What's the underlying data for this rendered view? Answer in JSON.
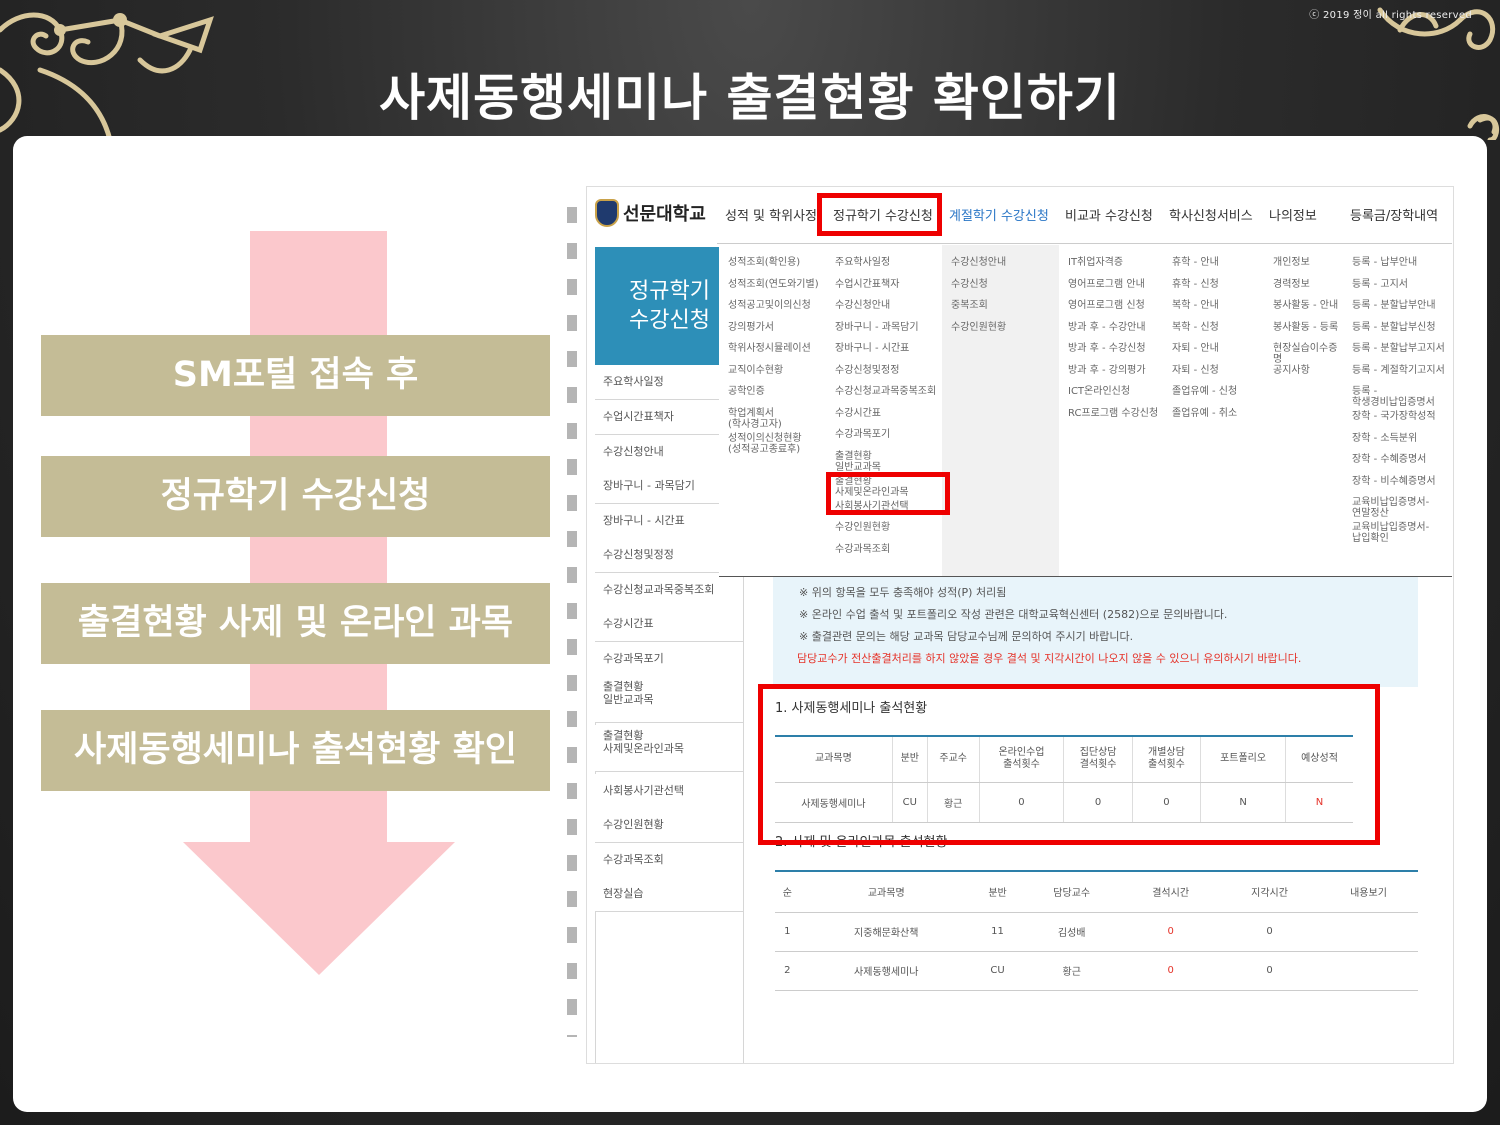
{
  "slide": {
    "title": "사제동행세미나 출결현황 확인하기",
    "copyright": "ⓒ 2019 정이 all rights reserved"
  },
  "steps": [
    "SM포털 접속 후",
    "정규학기 수강신청",
    "출결현황 사제 및 온라인 과목",
    "사제동행세미나 출석현황 확인"
  ],
  "colors": {
    "step_bg": "#c4bc96",
    "arrow": "#fbc8cc",
    "highlight": "#ee0000",
    "accent_blue": "#2d8fb8",
    "warning_red": "#e5332a"
  },
  "portal": {
    "logo": "선문대학교",
    "topnav": [
      "성적 및 학위사정",
      "정규학기 수강신청",
      "계절학기 수강신청",
      "비교과 수강신청",
      "학사신청서비스",
      "나의정보",
      "등록금/장학내역"
    ],
    "side_header": [
      "정규학기",
      "수강신청"
    ],
    "side_items": [
      "주요학사일정",
      "수업시간표책자",
      "수강신청안내",
      "장바구니 - 과목담기",
      "장바구니 - 시간표",
      "수강신청및정정",
      "수강신청교과목중복조회",
      "수강시간표",
      "수강과목포기",
      "출결현황\n일반교과목",
      "출결현황\n사제및온라인과목",
      "사회봉사기관선택",
      "수강인원현황",
      "수강과목조회",
      "현장실습"
    ],
    "mega_cols": [
      [
        "성적조회(확인용)",
        "성적조회(연도와기별)",
        "성적공고및이의신청",
        "강의평가서",
        "학위사정시뮬레이션",
        "교직이수현황",
        "공학인증",
        "학업계획서\n(학사경고자)",
        "성적이의신청현황\n(성적공고종료후)"
      ],
      [
        "주요학사일정",
        "수업시간표책자",
        "수강신청안내",
        "장바구니 - 과목담기",
        "장바구니 - 시간표",
        "수강신청및정정",
        "수강신청교과목중복조회",
        "수강시간표",
        "수강과목포기",
        "출결현황\n일반교과목",
        "출결현황\n사제및온라인과목",
        "사회봉사기관선택",
        "수강인원현황",
        "수강과목조회"
      ],
      [
        "수강신청안내",
        "수강신청",
        "중복조회",
        "수강인원현황"
      ],
      [
        "IT취업자격증",
        "영어프로그램 안내",
        "영어프로그램 신청",
        "방과 후 - 수강안내",
        "방과 후 - 수강신청",
        "방과 후 - 강의평가",
        "ICT온라인신청",
        "RC프로그램 수강신청"
      ],
      [
        "휴학 - 안내",
        "휴학 - 신청",
        "복학 - 안내",
        "복학 - 신청",
        "자퇴 - 안내",
        "자퇴 - 신청",
        "졸업유예 - 신청",
        "졸업유예 - 취소"
      ],
      [
        "개인정보",
        "경력정보",
        "봉사활동 - 안내",
        "봉사활동 - 등록",
        "현장실습이수증명",
        "공지사항"
      ],
      [
        "등록 - 납부안내",
        "등록 - 고지서",
        "등록 - 분할납부안내",
        "등록 - 분할납부신청",
        "등록 - 분할납부고지서",
        "등록 - 계절학기고지서",
        "등록 -\n학생경비납입증명서",
        "장학 - 국가장학성적",
        "장학 - 소득분위",
        "장학 - 수혜증명서",
        "장학 - 비수혜증명서",
        "교육비납입증명서-\n연말정산",
        "교육비납입증명서-\n납입확인"
      ]
    ],
    "info_lines": [
      "※ 위의 항목을 모두 충족해야 성적(P) 처리됨",
      "※ 온라인 수업 출석 및 포트폴리오 작성 관련은 대학교육혁신센터 (2582)으로 문의바랍니다.",
      "※ 출결관련 문의는 해당 교과목 담당교수님께 문의하여 주시기 바랍니다."
    ],
    "info_warning": "담당교수가 전산출결처리를 하지 않았을 경우 결석 및 지각시간이 나오지 않을 수 있으니 유의하시기 바랍니다.",
    "table1": {
      "title": "1. 사제동행세미나 출석현황",
      "headers": [
        "교과목명",
        "분반",
        "주교수",
        "온라인수업\n출석횟수",
        "집단상담\n결석횟수",
        "개별상담\n출석횟수",
        "포트폴리오",
        "예상성적"
      ],
      "row": [
        "사제동행세미나",
        "CU",
        "황근",
        "0",
        "0",
        "0",
        "N",
        "N"
      ]
    },
    "table2": {
      "title": "2. 사제 및 온라인과목 출석현황",
      "headers": [
        "순",
        "교과목명",
        "분반",
        "담당교수",
        "결석시간",
        "지각시간",
        "내용보기"
      ],
      "rows": [
        [
          "1",
          "지중해문화산책",
          "11",
          "김성배",
          "0",
          "0",
          ""
        ],
        [
          "2",
          "사제동행세미나",
          "CU",
          "황근",
          "0",
          "0",
          ""
        ]
      ]
    }
  }
}
